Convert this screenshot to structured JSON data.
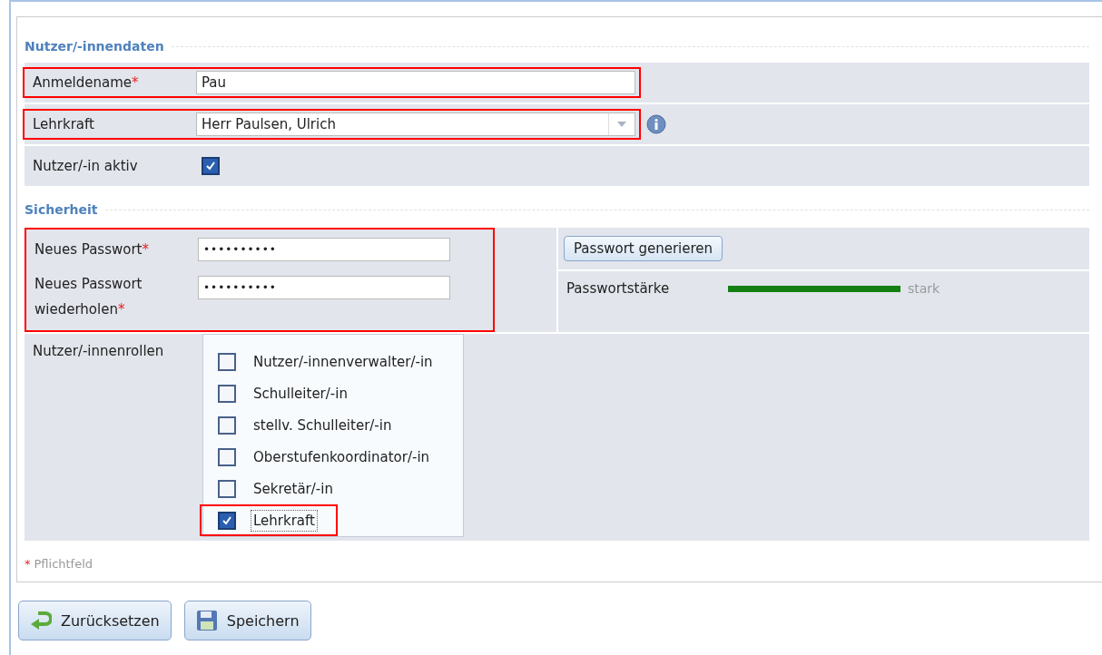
{
  "user_section": {
    "title": "Nutzer/-innendaten",
    "fields": [
      {
        "kind": "text",
        "label": "Anmeldename",
        "required": true,
        "value": "Pau",
        "highlighted": true
      },
      {
        "kind": "select",
        "label": "Lehrkraft",
        "required": false,
        "value": "Herr Paulsen, Ulrich",
        "highlighted": true
      },
      {
        "kind": "checkbox",
        "label": "Nutzer/-in aktiv",
        "required": false,
        "checked": true,
        "highlighted": false
      }
    ]
  },
  "security_section": {
    "title": "Sicherheit",
    "highlighted": true,
    "password": {
      "label": "Neues Passwort",
      "required": true,
      "value": "••••••••••"
    },
    "password_repeat": {
      "label_line1": "Neues Passwort",
      "label_line2": "wiederholen",
      "required": true,
      "value": "••••••••••"
    },
    "generate_button": "Passwort generieren",
    "strength": {
      "label": "Passwortstärke",
      "level": 1,
      "reading": "stark"
    }
  },
  "roles": {
    "label": "Nutzer/-innenrollen",
    "items": [
      {
        "label": "Nutzer/-innenverwalter/-in",
        "checked": false,
        "highlighted": false
      },
      {
        "label": "Schulleiter/-in",
        "checked": false,
        "highlighted": false
      },
      {
        "label": "stellv. Schulleiter/-in",
        "checked": false,
        "highlighted": false
      },
      {
        "label": "Oberstufenkoordinator/-in",
        "checked": false,
        "highlighted": false
      },
      {
        "label": "Sekretär/-in",
        "checked": false,
        "highlighted": false
      },
      {
        "label": "Lehrkraft",
        "checked": true,
        "highlighted": true
      }
    ]
  },
  "required_note": {
    "mark": "*",
    "text": "Pflichtfeld"
  },
  "buttons": [
    {
      "kind": "reset",
      "label": "Zurücksetzen"
    },
    {
      "kind": "save",
      "label": "Speichern"
    }
  ]
}
